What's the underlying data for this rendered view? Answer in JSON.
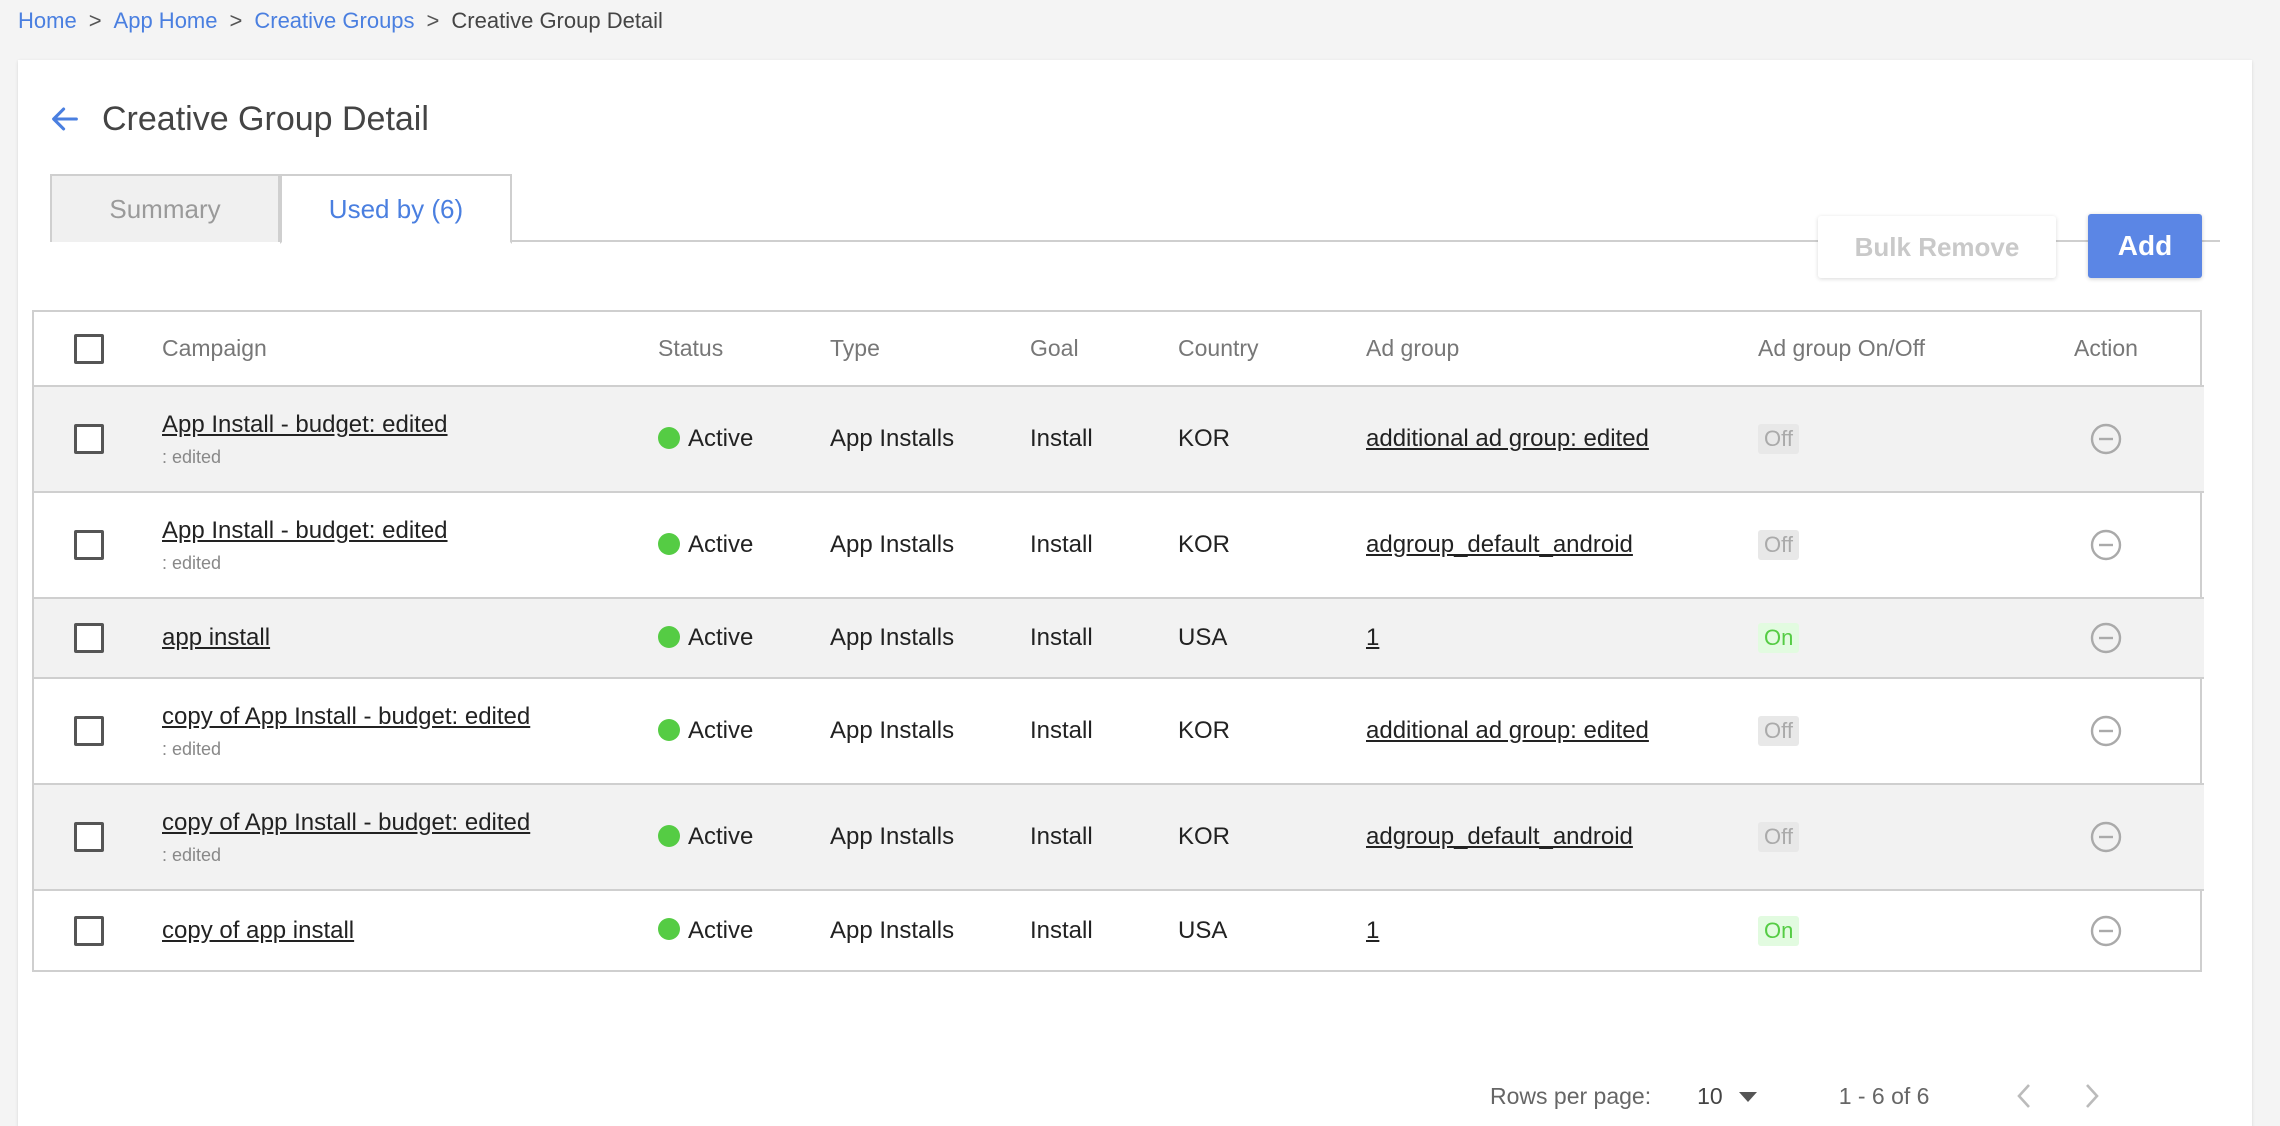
{
  "breadcrumb": [
    {
      "label": "Home",
      "link": true
    },
    {
      "label": "App Home",
      "link": true
    },
    {
      "label": "Creative Groups",
      "link": true
    },
    {
      "label": "Creative Group Detail",
      "link": false
    }
  ],
  "breadcrumb_separator": ">",
  "page": {
    "title": "Creative Group Detail"
  },
  "tabs": [
    {
      "label": "Summary",
      "active": false
    },
    {
      "label": "Used by (6)",
      "active": true
    }
  ],
  "toolbar": {
    "bulk_remove_label": "Bulk Remove",
    "add_label": "Add"
  },
  "table": {
    "headers": {
      "campaign": "Campaign",
      "status": "Status",
      "type": "Type",
      "goal": "Goal",
      "country": "Country",
      "ad_group": "Ad group",
      "ad_group_onoff": "Ad group On/Off",
      "action": "Action"
    },
    "rows": [
      {
        "campaign": "App Install - budget: edited",
        "sub": ": edited",
        "status": "Active",
        "type": "App Installs",
        "goal": "Install",
        "country": "KOR",
        "ad_group": "additional ad group: edited",
        "onoff": "Off"
      },
      {
        "campaign": "App Install - budget: edited",
        "sub": ": edited",
        "status": "Active",
        "type": "App Installs",
        "goal": "Install",
        "country": "KOR",
        "ad_group": "adgroup_default_android",
        "onoff": "Off"
      },
      {
        "campaign": "app install",
        "sub": "",
        "status": "Active",
        "type": "App Installs",
        "goal": "Install",
        "country": "USA",
        "ad_group": "1",
        "onoff": "On"
      },
      {
        "campaign": "copy of App Install - budget: edited",
        "sub": ": edited",
        "status": "Active",
        "type": "App Installs",
        "goal": "Install",
        "country": "KOR",
        "ad_group": "additional ad group: edited",
        "onoff": "Off"
      },
      {
        "campaign": "copy of App Install - budget: edited",
        "sub": ": edited",
        "status": "Active",
        "type": "App Installs",
        "goal": "Install",
        "country": "KOR",
        "ad_group": "adgroup_default_android",
        "onoff": "Off"
      },
      {
        "campaign": "copy of app install",
        "sub": "",
        "status": "Active",
        "type": "App Installs",
        "goal": "Install",
        "country": "USA",
        "ad_group": "1",
        "onoff": "On"
      }
    ]
  },
  "pagination": {
    "rows_per_page_label": "Rows per page:",
    "rows_per_page": "10",
    "range": "1 - 6 of 6"
  },
  "colors": {
    "accent": "#4a7fe0",
    "add_button": "#5b86e5",
    "status_active": "#55cc44",
    "on_pill_bg": "#e2fbe0",
    "off_pill_bg": "#e8e8e8"
  },
  "icons": {
    "back": "arrow-left-icon",
    "action": "remove-circle-icon",
    "caret": "caret-down-icon",
    "prev": "chevron-left-icon",
    "next": "chevron-right-icon"
  }
}
